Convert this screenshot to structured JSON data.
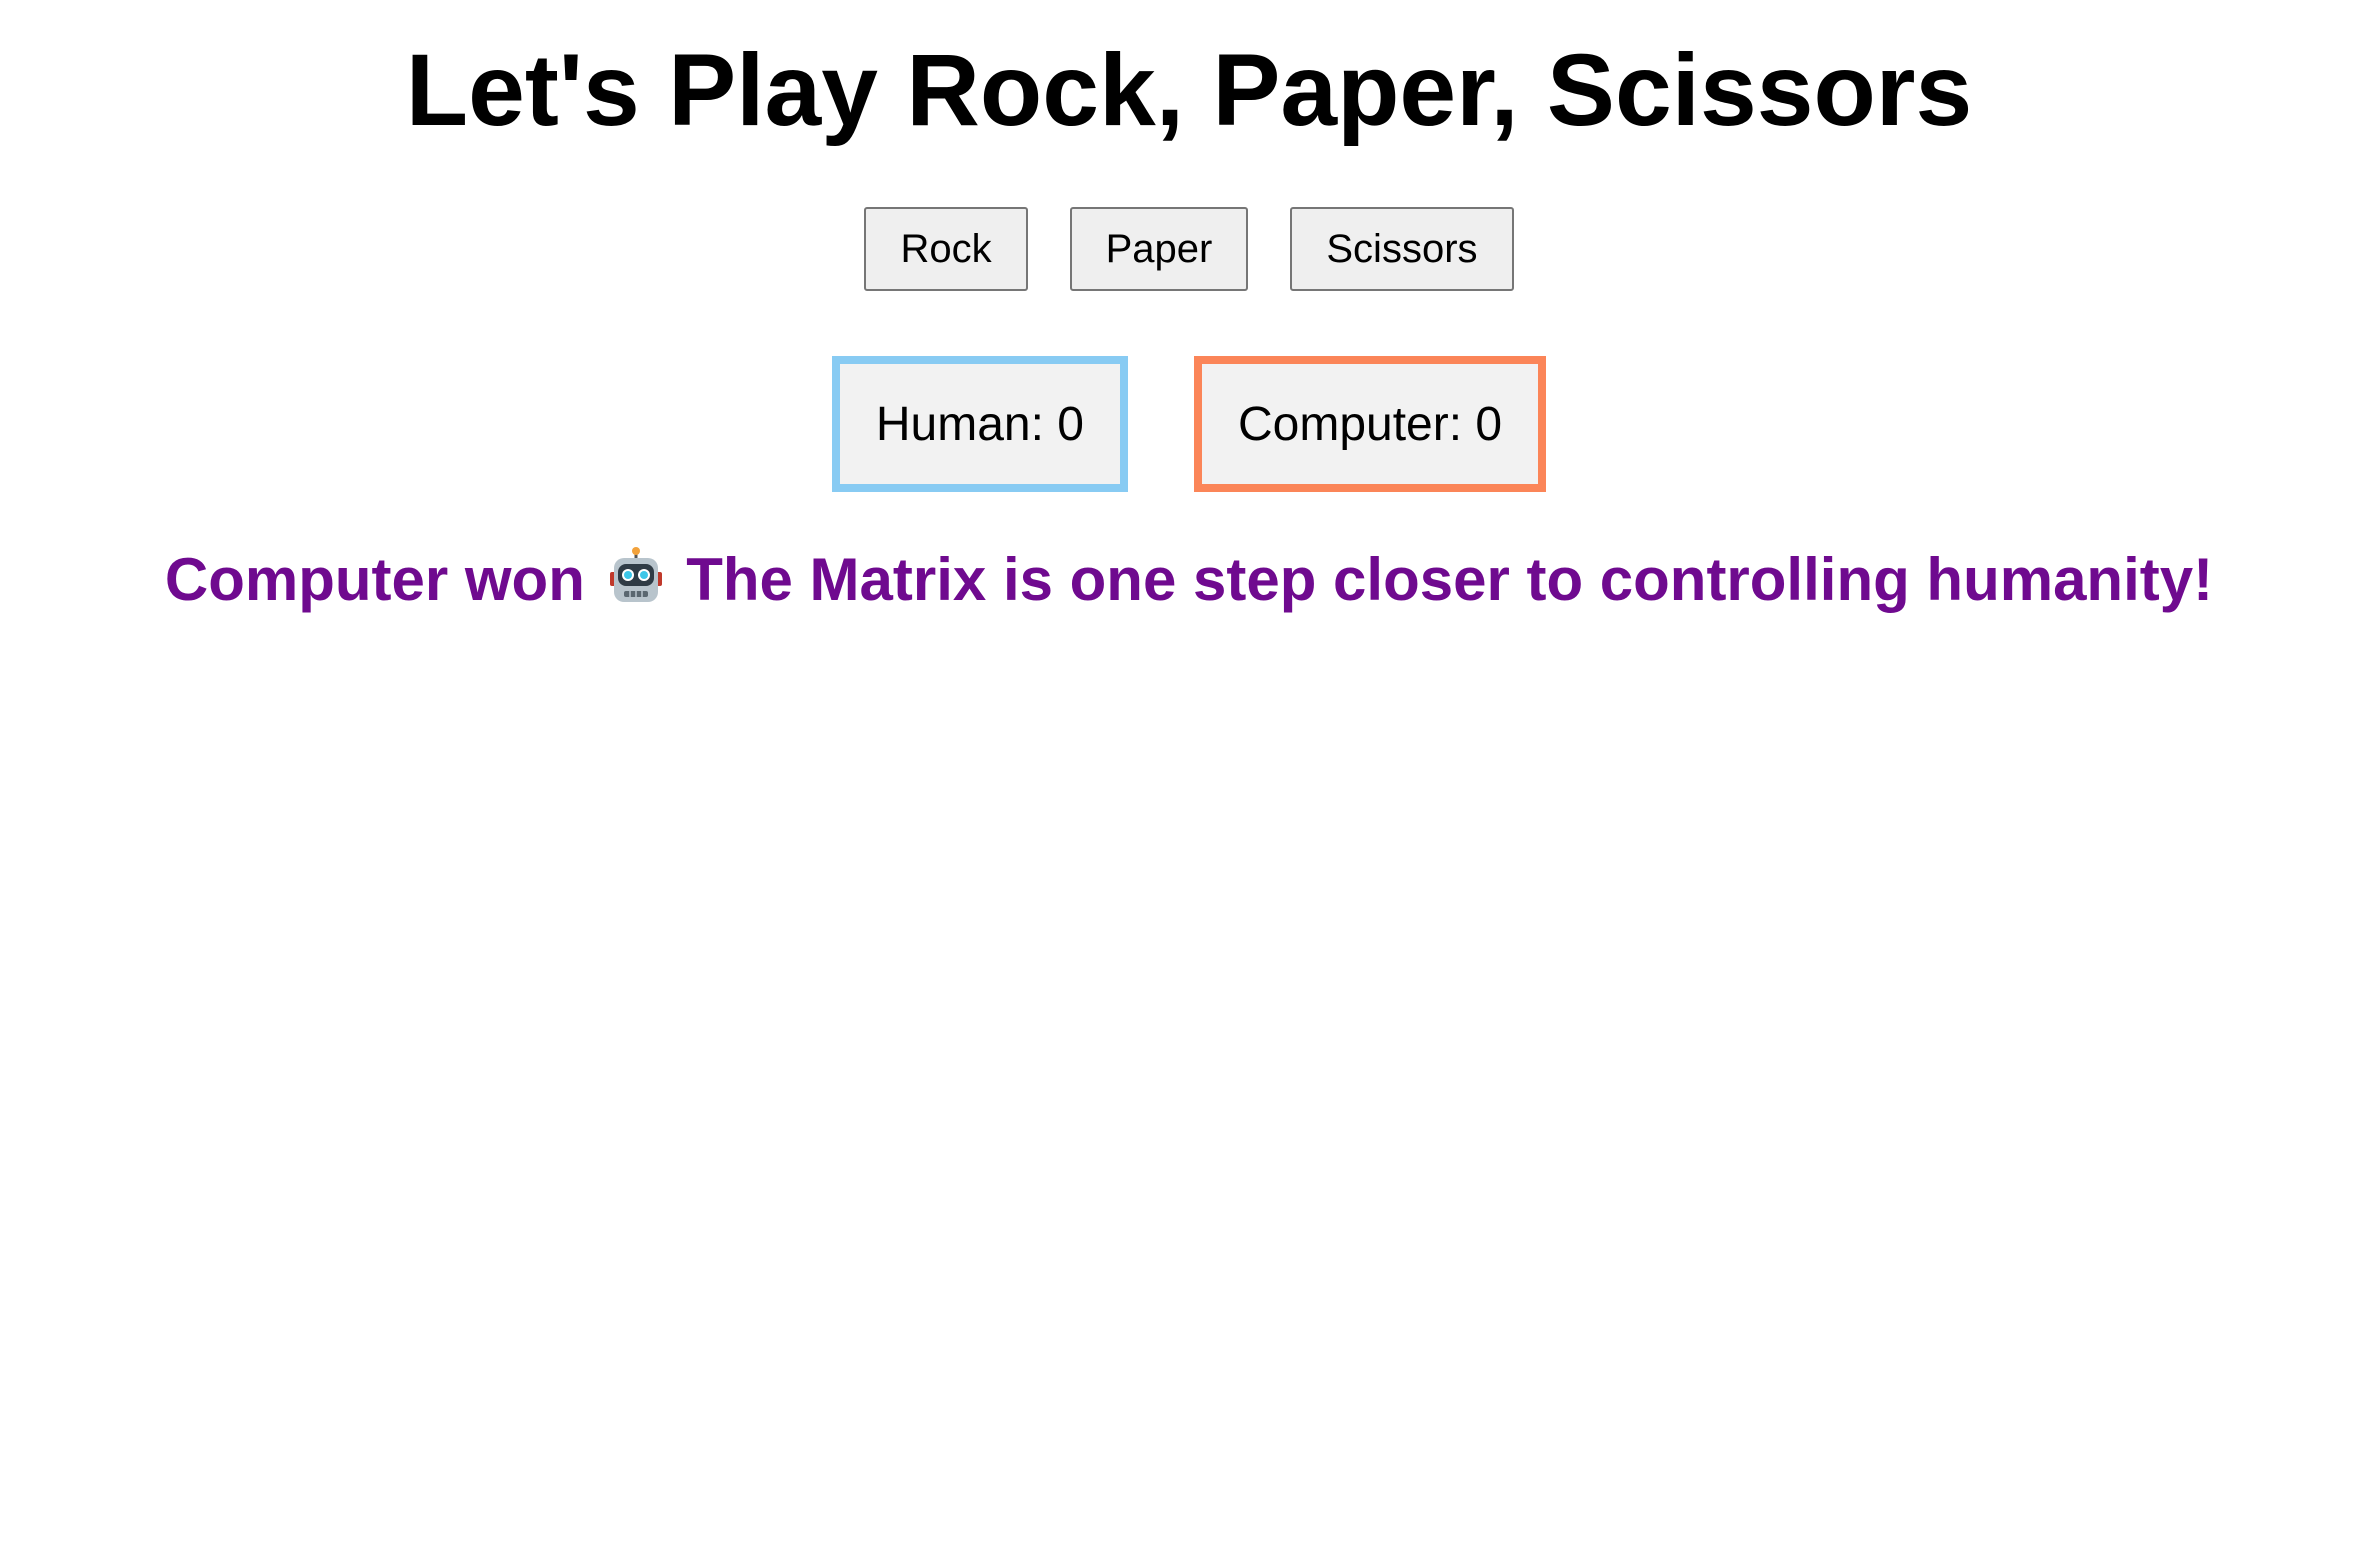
{
  "page": {
    "title": "Let's Play Rock, Paper, Scissors"
  },
  "choices": {
    "rock": "Rock",
    "paper": "Paper",
    "scissors": "Scissors"
  },
  "scores": {
    "human_label": "Human: 0",
    "computer_label": "Computer: 0",
    "human_border_color": "#88cbf3",
    "computer_border_color": "#fb8558"
  },
  "result": {
    "prefix": "Computer won",
    "icon": "robot-icon",
    "message": "The Matrix is one step closer to controlling humanity!",
    "color": "#6f0a8f"
  }
}
